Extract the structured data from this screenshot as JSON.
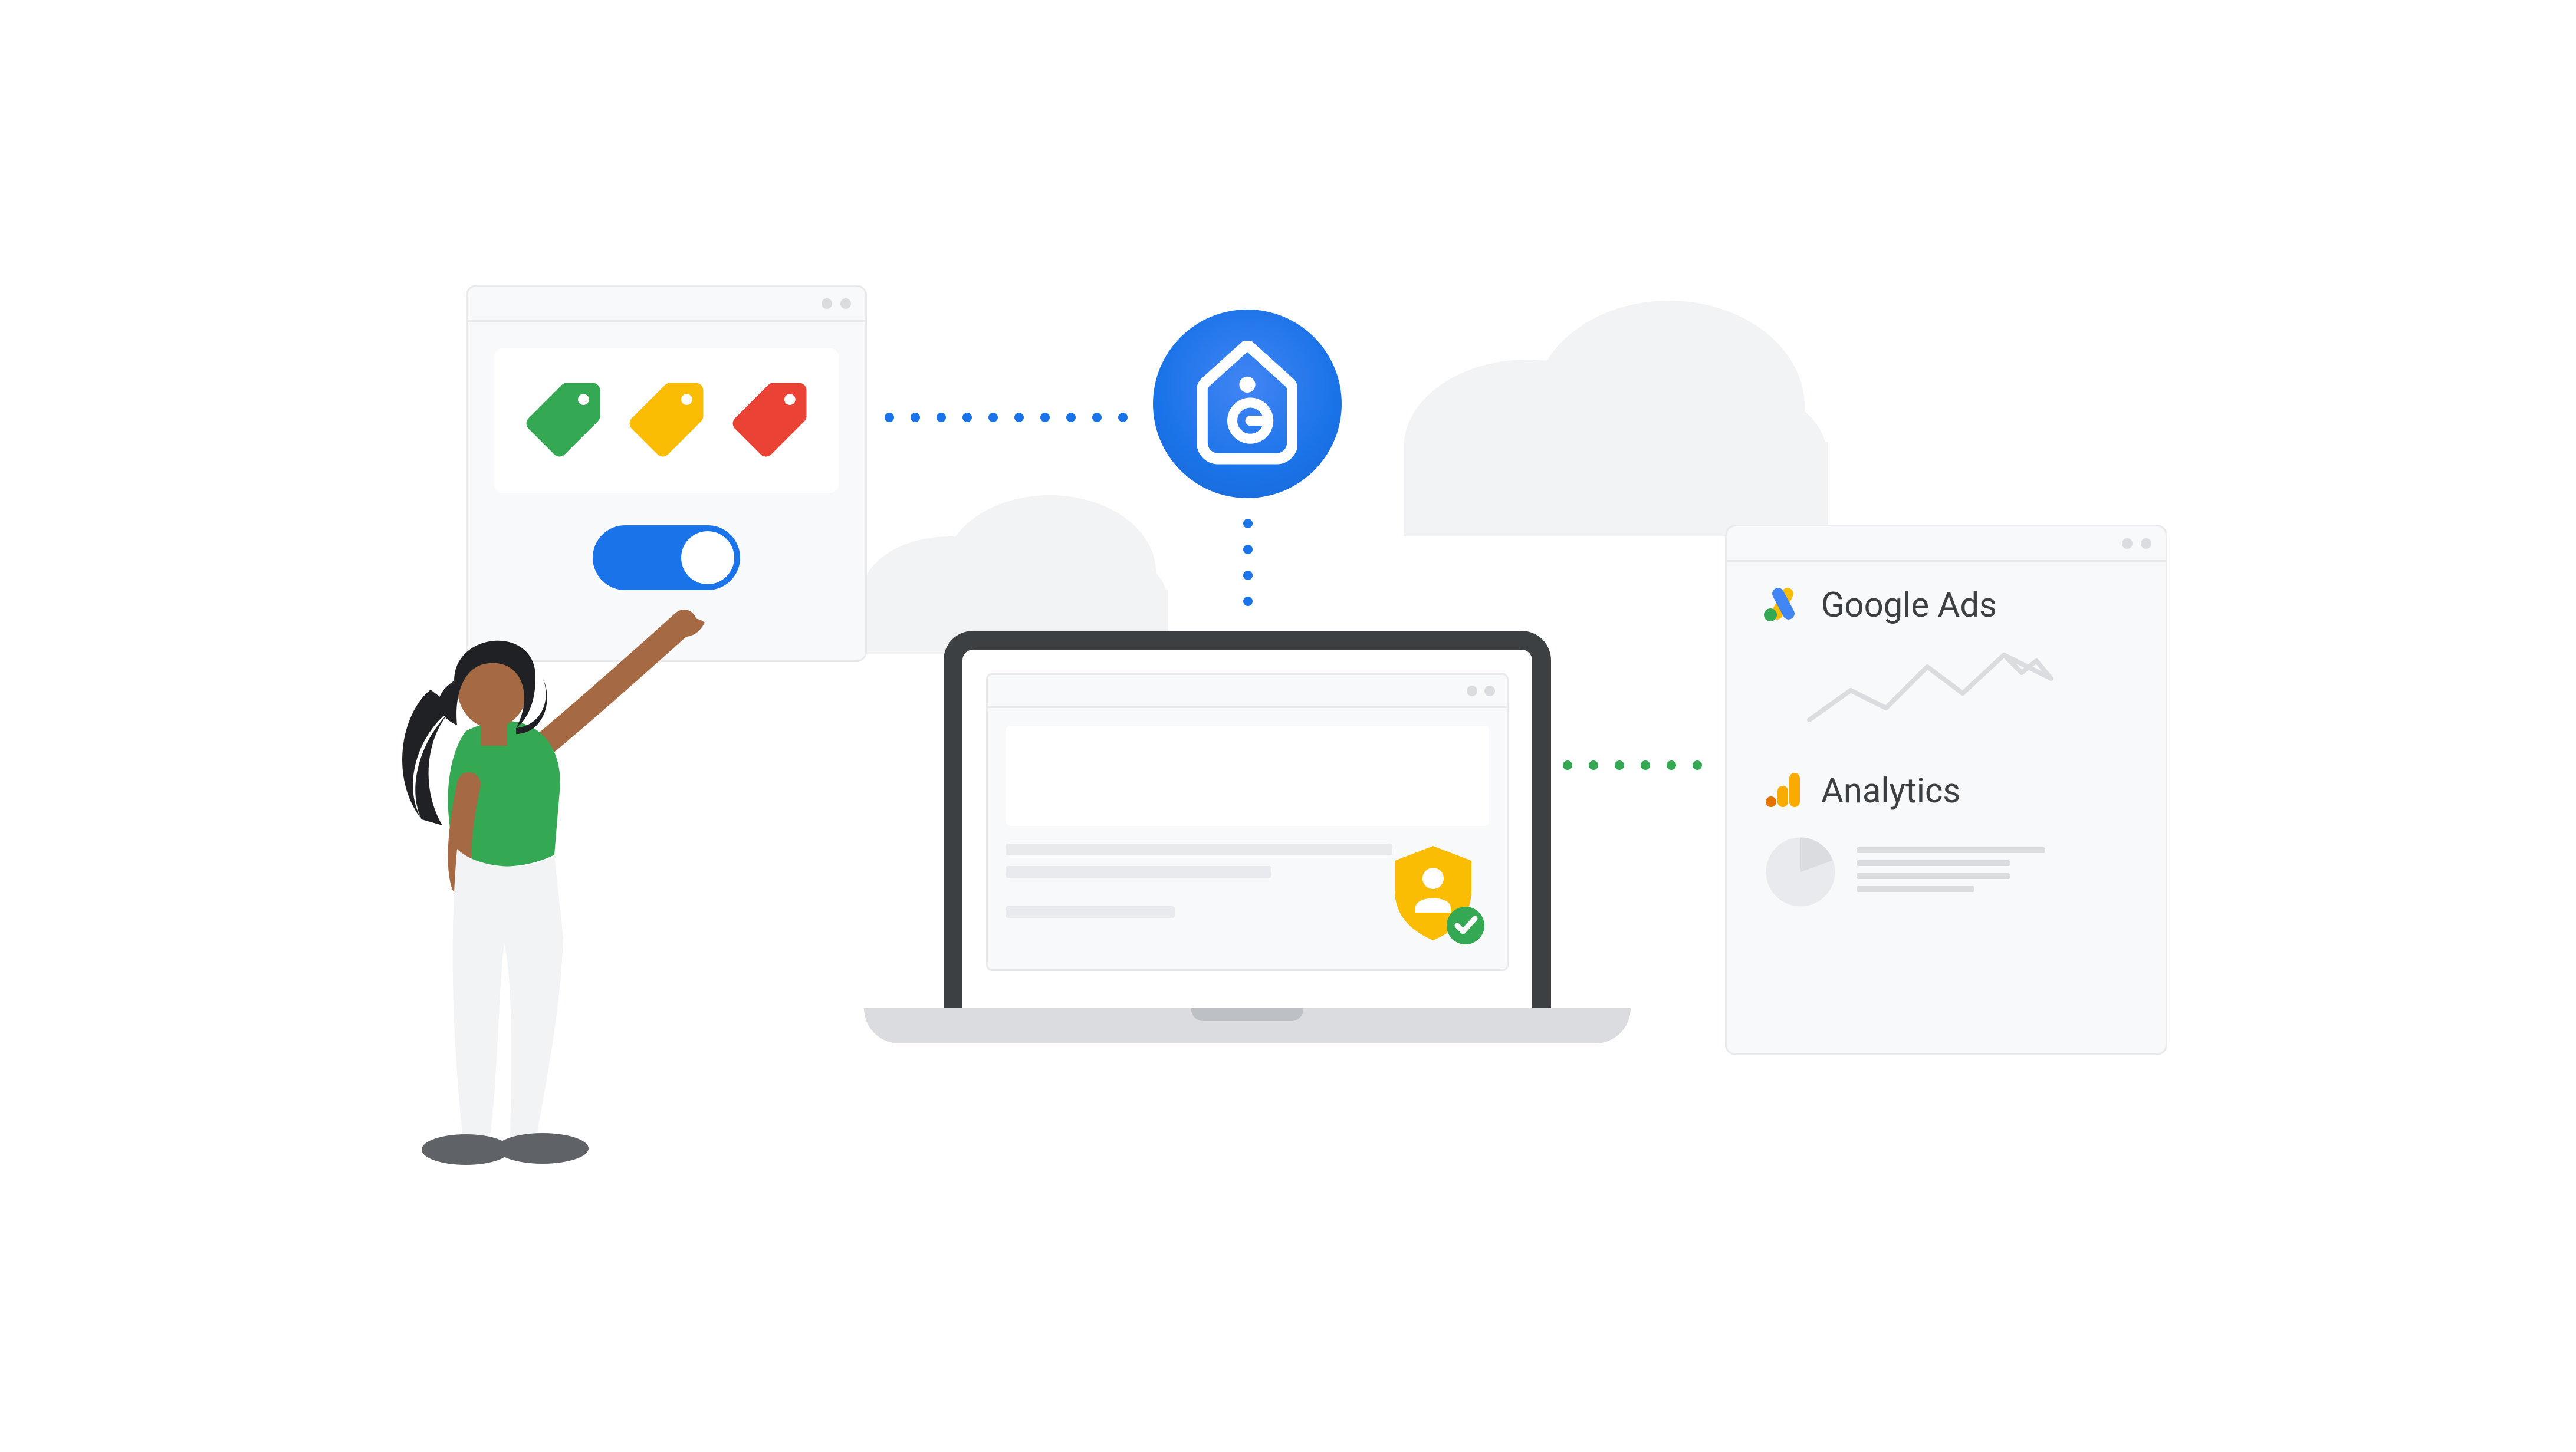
{
  "products": {
    "ads_label": "Google Ads",
    "analytics_label": "Analytics"
  },
  "icons": {
    "tag_green": "tag-icon-green",
    "tag_yellow": "tag-icon-yellow",
    "tag_red": "tag-icon-red",
    "google_tag": "google-tag-icon",
    "shield_user": "shield-user-icon",
    "check_badge": "check-circle-icon",
    "ads_logo": "google-ads-logo-icon",
    "analytics_logo": "google-analytics-logo-icon",
    "pie_chart": "pie-chart-icon",
    "line_chart": "line-chart-icon"
  },
  "colors": {
    "google_blue": "#1a73e8",
    "google_red": "#ea4335",
    "google_yellow": "#fbbc04",
    "google_green": "#34a853",
    "analytics_orange": "#f9ab00",
    "grey_bg": "#f8f9fa",
    "grey_border": "#e8eaed",
    "text": "#3c4043"
  }
}
